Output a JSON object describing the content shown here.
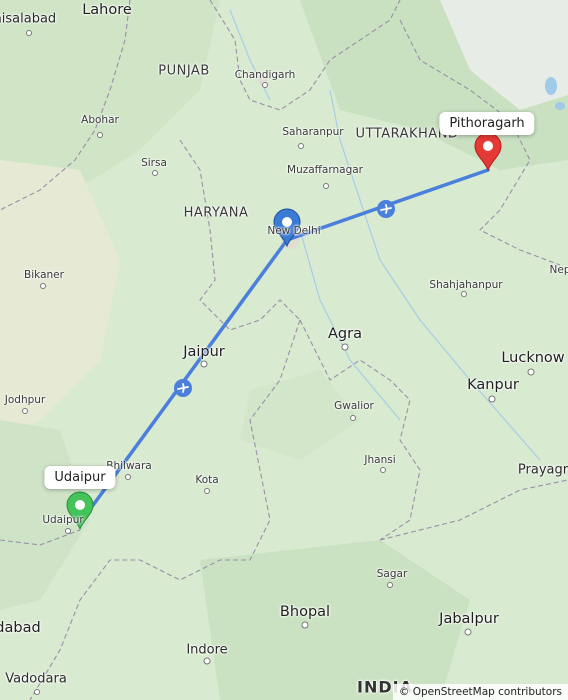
{
  "markers": {
    "origin": "Udaipur",
    "destination": "Pithoragarh",
    "origin_color": "#43c35a",
    "stopover_color": "#3a7bd5",
    "destination_color": "#e53935"
  },
  "route": {
    "color": "#4a7fdb",
    "mode_icon": "airplane-icon"
  },
  "regions": {
    "punjab": "PUNJAB",
    "haryana": "HARYANA",
    "uttarakhand": "UTTARAKHAND"
  },
  "places": {
    "lahore": "Lahore",
    "faisalabad": "aisalabad",
    "chandigarh": "Chandigarh",
    "abohar": "Abohar",
    "saharanpur": "Saharanpur",
    "sirsa": "Sirsa",
    "muzaffarnagar": "Muzaffarnagar",
    "new_delhi": "New Delhi",
    "bikaner": "Bikaner",
    "shahjahanpur": "Shahjahanpur",
    "nepal": "Nep",
    "agra": "Agra",
    "jaipur": "Jaipur",
    "lucknow": "Lucknow",
    "kanpur": "Kanpur",
    "jodhpur": "Jodhpur",
    "gwalior": "Gwalior",
    "jhansi": "Jhansi",
    "bhilwara": "Bhilwara",
    "prayagraj": "Prayagr",
    "kota": "Kota",
    "udaipur_map": "Udaipur",
    "sagar": "Sagar",
    "bhopal": "Bhopal",
    "jabalpur": "Jabalpur",
    "ahmedabad": "dabad",
    "indore": "Indore",
    "vadodara": "Vadodara",
    "india": "INDIA"
  },
  "attribution": {
    "symbol": "©",
    "text": "OpenStreetMap contributors"
  }
}
